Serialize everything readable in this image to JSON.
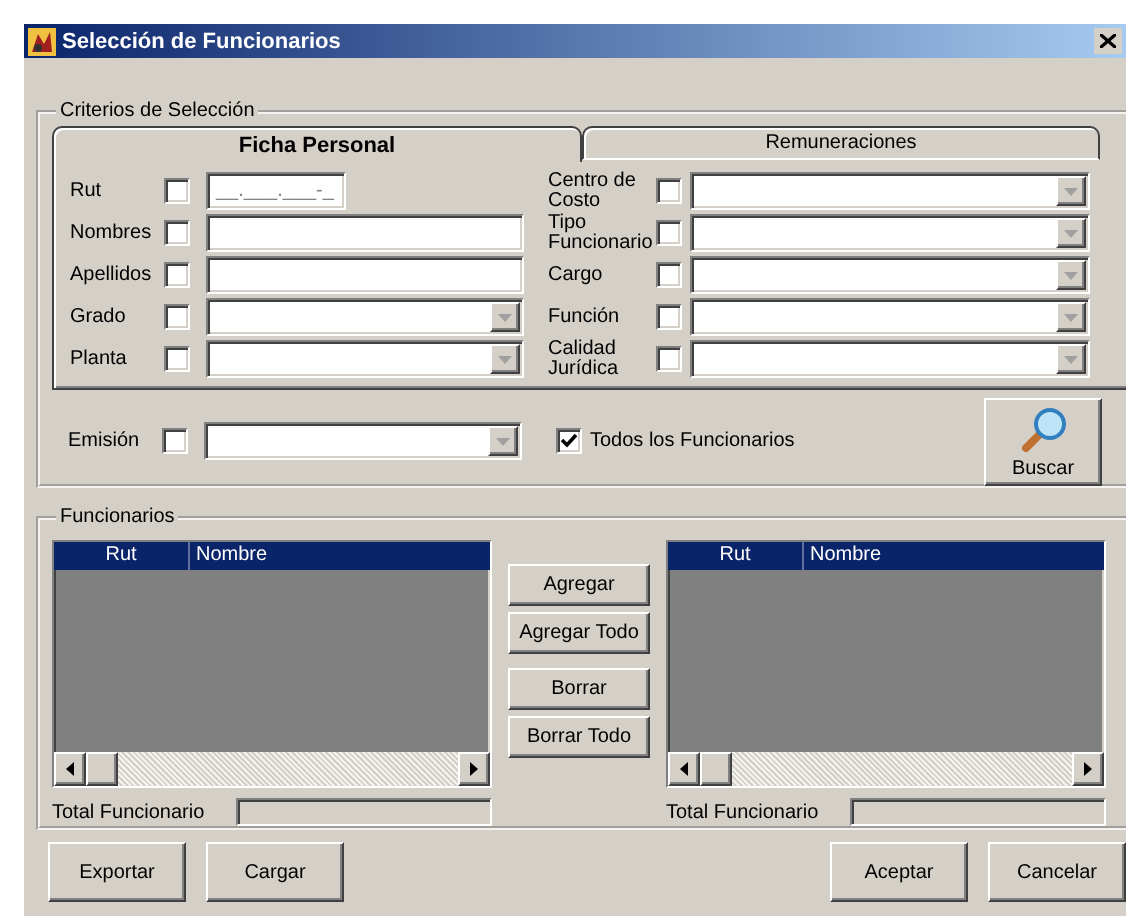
{
  "window": {
    "title": "Selección de Funcionarios"
  },
  "criteria": {
    "legend": "Criterios de Selección",
    "tabs": [
      {
        "label": "Ficha Personal",
        "selected": true
      },
      {
        "label": "Remuneraciones",
        "selected": false
      }
    ],
    "left_fields": [
      {
        "label": "Rut",
        "kind": "text",
        "checked": false,
        "value": "__.___.___-_"
      },
      {
        "label": "Nombres",
        "kind": "text",
        "checked": false
      },
      {
        "label": "Apellidos",
        "kind": "text",
        "checked": false
      },
      {
        "label": "Grado",
        "kind": "combo",
        "checked": false
      },
      {
        "label": "Planta",
        "kind": "combo",
        "checked": false
      }
    ],
    "right_fields": [
      {
        "label": "Centro de Costo",
        "kind": "combo",
        "checked": false
      },
      {
        "label": "Tipo Funcionario",
        "kind": "combo",
        "checked": false
      },
      {
        "label": "Cargo",
        "kind": "combo",
        "checked": false
      },
      {
        "label": "Función",
        "kind": "combo",
        "checked": false
      },
      {
        "label": "Calidad Jurídica",
        "kind": "combo",
        "checked": false
      }
    ],
    "emission": {
      "label": "Emisión",
      "checked": false
    },
    "all_employees": {
      "label": "Todos los Funcionarios",
      "checked": true
    },
    "search_button": "Buscar"
  },
  "employees": {
    "legend": "Funcionarios",
    "lists": [
      {
        "columns": [
          "Rut",
          "Nombre"
        ],
        "total_label": "Total Funcionario"
      },
      {
        "columns": [
          "Rut",
          "Nombre"
        ],
        "total_label": "Total Funcionario"
      }
    ],
    "transfer_buttons": [
      "Agregar",
      "Agregar Todo",
      "Borrar",
      "Borrar Todo"
    ]
  },
  "left_buttons": [
    "Exportar",
    "Cargar"
  ],
  "right_buttons": [
    "Aceptar",
    "Cancelar"
  ]
}
